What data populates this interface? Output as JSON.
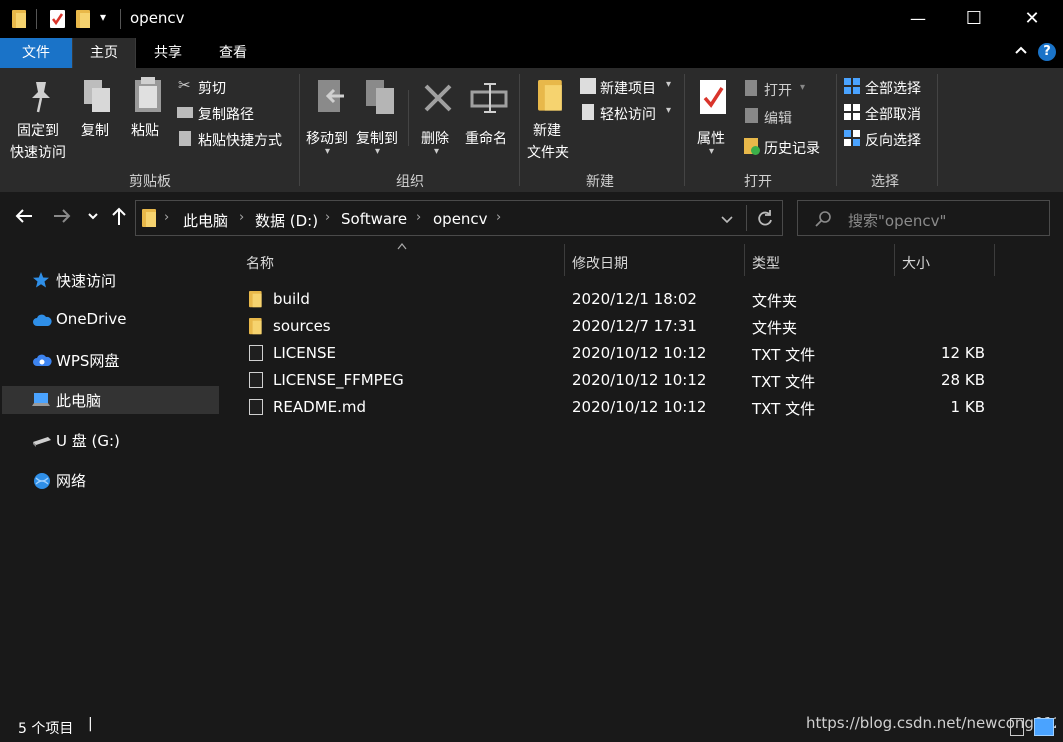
{
  "window": {
    "title": "opencv",
    "minimize_glyph": "—",
    "maximize_glyph": "☐",
    "close_glyph": "✕"
  },
  "menu": {
    "tabs": [
      "文件",
      "主页",
      "共享",
      "查看"
    ],
    "active_tab": "主页",
    "file_tab_color": "#1a73c8",
    "help_glyph": "?"
  },
  "ribbon": {
    "clipboard": {
      "pin_line1": "固定到",
      "pin_line2": "快速访问",
      "copy": "复制",
      "paste": "粘贴",
      "cut": "剪切",
      "copy_path": "复制路径",
      "paste_shortcut": "粘贴快捷方式",
      "group": "剪贴板"
    },
    "organize": {
      "move_to": "移动到",
      "copy_to": "复制到",
      "delete": "删除",
      "rename": "重命名",
      "group": "组织"
    },
    "new": {
      "new_folder_line1": "新建",
      "new_folder_line2": "文件夹",
      "new_item": "新建项目",
      "easy_access": "轻松访问",
      "group": "新建"
    },
    "open": {
      "properties": "属性",
      "open": "打开",
      "edit": "编辑",
      "history": "历史记录",
      "group": "打开"
    },
    "select": {
      "select_all": "全部选择",
      "select_none": "全部取消",
      "invert": "反向选择",
      "group": "选择"
    }
  },
  "nav": {
    "breadcrumb": [
      "此电脑",
      "数据 (D:)",
      "Software",
      "opencv"
    ],
    "search_placeholder": "搜索\"opencv\""
  },
  "sidebar": {
    "items": [
      {
        "label": "快速访问",
        "icon": "star-icon"
      },
      {
        "label": "OneDrive",
        "icon": "cloud-icon"
      },
      {
        "label": "WPS网盘",
        "icon": "cloud-icon"
      },
      {
        "label": "此电脑",
        "icon": "computer-icon",
        "selected": true
      },
      {
        "label": "U 盘 (G:)",
        "icon": "drive-icon"
      },
      {
        "label": "网络",
        "icon": "network-icon"
      }
    ]
  },
  "columns": {
    "name": "名称",
    "modified": "修改日期",
    "type": "类型",
    "size": "大小"
  },
  "files": [
    {
      "name": "build",
      "modified": "2020/12/1 18:02",
      "type": "文件夹",
      "size": "",
      "kind": "folder"
    },
    {
      "name": "sources",
      "modified": "2020/12/7 17:31",
      "type": "文件夹",
      "size": "",
      "kind": "folder"
    },
    {
      "name": "LICENSE",
      "modified": "2020/10/12 10:12",
      "type": "TXT 文件",
      "size": "12 KB",
      "kind": "file"
    },
    {
      "name": "LICENSE_FFMPEG",
      "modified": "2020/10/12 10:12",
      "type": "TXT 文件",
      "size": "28 KB",
      "kind": "file"
    },
    {
      "name": "README.md",
      "modified": "2020/10/12 10:12",
      "type": "TXT 文件",
      "size": "1 KB",
      "kind": "file"
    }
  ],
  "status": {
    "item_count": "5 个项目",
    "watermark": "https://blog.csdn.net/newcong0123"
  }
}
